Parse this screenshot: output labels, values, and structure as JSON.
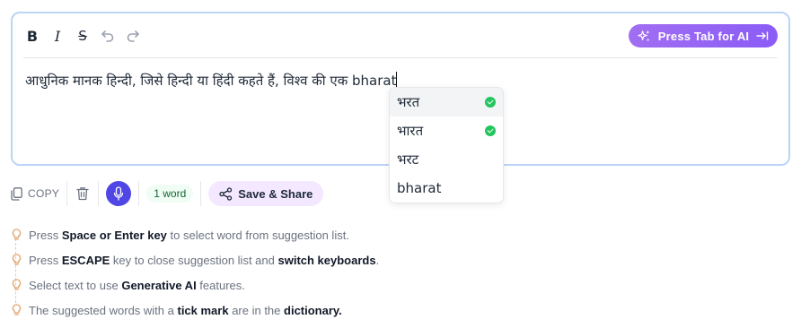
{
  "toolbar": {
    "bold": "B",
    "italic": "I",
    "strike": "S",
    "undo_icon": "undo-icon",
    "redo_icon": "redo-icon",
    "ai_button_label": "Press Tab for AI"
  },
  "editor": {
    "text_prefix": "आधुनिक मानक हिन्दी, जिसे हिन्दी या हिंदी कहते हैं, विश्व की एक ",
    "current_word": "bharat"
  },
  "suggestions": [
    {
      "text": "भरत",
      "in_dictionary": true,
      "active": true
    },
    {
      "text": "भारत",
      "in_dictionary": true,
      "active": false
    },
    {
      "text": "भरट",
      "in_dictionary": false,
      "active": false
    },
    {
      "text": "bharat",
      "in_dictionary": false,
      "active": false
    }
  ],
  "actions": {
    "copy_label": "COPY",
    "word_count": "1 word",
    "share_label": "Save & Share"
  },
  "tips": [
    {
      "pre": "Press ",
      "b1": "Space or Enter key",
      "mid": " to select word from suggestion list.",
      "b2": "",
      "post": ""
    },
    {
      "pre": "Press ",
      "b1": "ESCAPE",
      "mid": " key to close suggestion list and ",
      "b2": "switch keyboards",
      "post": "."
    },
    {
      "pre": "Select text to use ",
      "b1": "Generative AI",
      "mid": " features.",
      "b2": "",
      "post": ""
    },
    {
      "pre": "The suggested words with a ",
      "b1": "tick mark",
      "mid": " are in the ",
      "b2": "dictionary.",
      "post": ""
    }
  ],
  "colors": {
    "accent": "#8b5cf6",
    "mic": "#4f46e5",
    "check": "#22c55e",
    "editor_border": "#bcd4f6"
  }
}
